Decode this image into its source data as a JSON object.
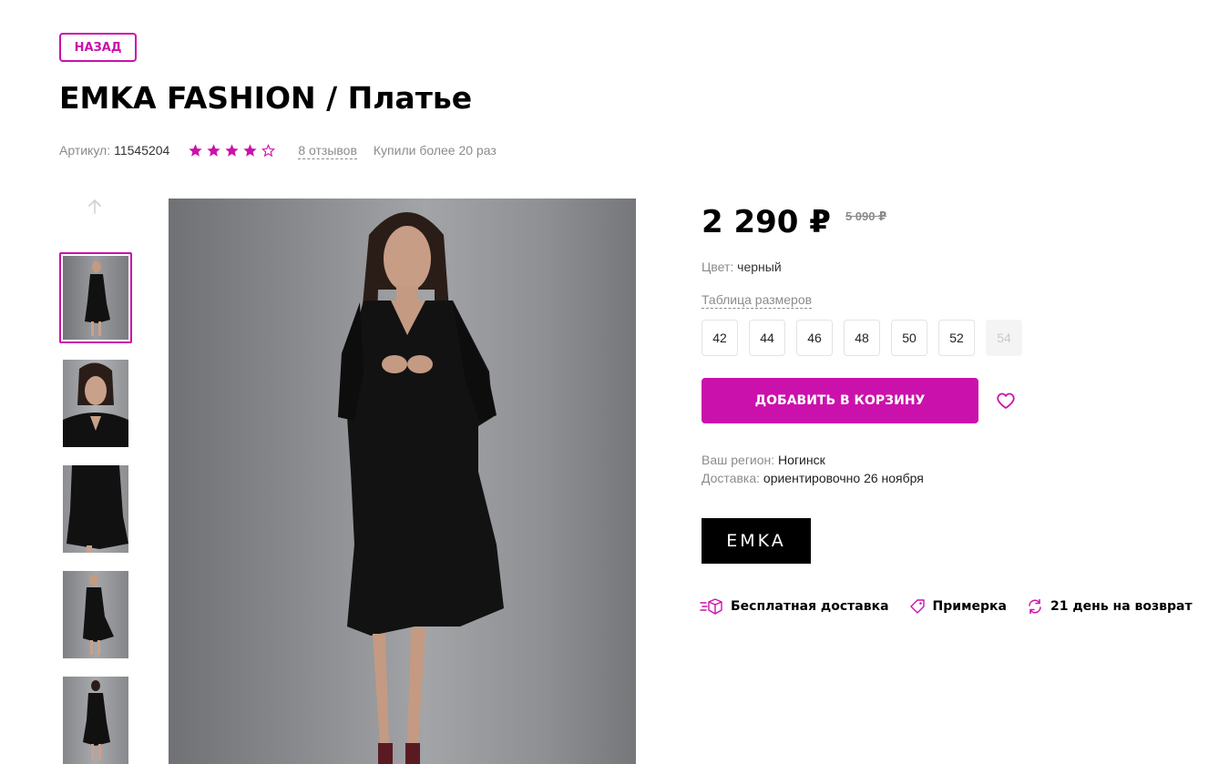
{
  "back_label": "НАЗАД",
  "product": {
    "title": "EMKA FASHION / Платье",
    "article_label": "Артикул:",
    "article_value": "11545204",
    "rating": 4,
    "rating_max": 5,
    "reviews": "8 отзывов",
    "bought": "Купили более 20 раз"
  },
  "price": {
    "current": "2 290 ₽",
    "old": "5 090 ₽"
  },
  "color": {
    "label": "Цвет:",
    "value": "черный"
  },
  "size_table_label": "Таблица размеров",
  "sizes": [
    {
      "label": "42",
      "available": true
    },
    {
      "label": "44",
      "available": true
    },
    {
      "label": "46",
      "available": true
    },
    {
      "label": "48",
      "available": true
    },
    {
      "label": "50",
      "available": true
    },
    {
      "label": "52",
      "available": true
    },
    {
      "label": "54",
      "available": false
    }
  ],
  "cart_button": "ДОБАВИТЬ В КОРЗИНУ",
  "region": {
    "label": "Ваш регион:",
    "value": "Ногинск",
    "delivery_label": "Доставка:",
    "delivery_value": "ориентировочно 26 ноября"
  },
  "brand_logo": "EMKA",
  "features": [
    {
      "icon": "delivery-icon",
      "label": "Бесплатная доставка"
    },
    {
      "icon": "tag-icon",
      "label": "Примерка"
    },
    {
      "icon": "return-icon",
      "label": "21 день на возврат"
    }
  ],
  "colors": {
    "accent": "#cb11ab",
    "muted_text": "#8b8b8b"
  }
}
